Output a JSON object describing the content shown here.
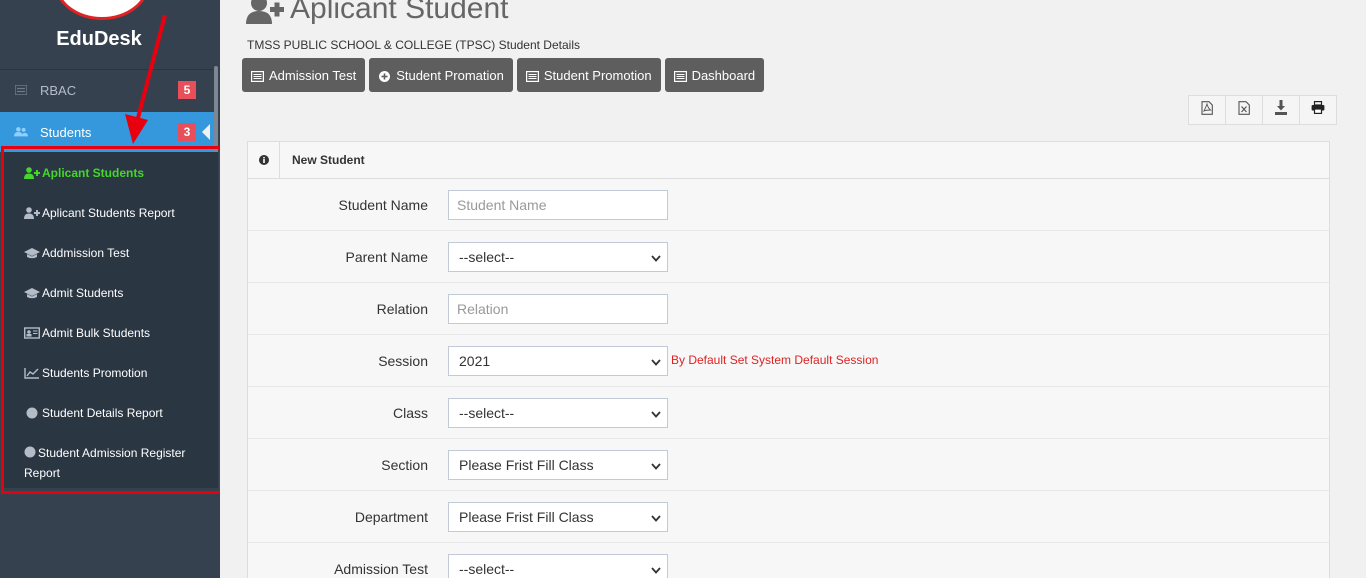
{
  "sidebar": {
    "brand": "EduDesk",
    "menu": [
      {
        "label": "RBAC",
        "badge": "5",
        "icon": "list-icon"
      },
      {
        "label": "Students",
        "badge": "3",
        "icon": "users-icon"
      }
    ],
    "submenu": [
      {
        "label": "Aplicant Students",
        "icon": "user-plus-icon",
        "active": true
      },
      {
        "label": "Aplicant Students Report",
        "icon": "user-plus-icon"
      },
      {
        "label": "Addmission Test",
        "icon": "graduation-cap-icon"
      },
      {
        "label": "Admit Students",
        "icon": "graduation-cap-icon"
      },
      {
        "label": "Admit Bulk Students",
        "icon": "id-card-icon"
      },
      {
        "label": "Students Promotion",
        "icon": "line-chart-icon"
      },
      {
        "label": "Student Details Report",
        "icon": "circle-icon"
      },
      {
        "label": "Student Admission Register Report",
        "icon": "circle-icon"
      }
    ]
  },
  "header": {
    "title": "Aplicant Student",
    "subtitle": "TMSS PUBLIC SCHOOL & COLLEGE (TPSC) Student Details"
  },
  "toolbar": {
    "buttons": [
      {
        "label": "Admission Test",
        "icon": "list-icon"
      },
      {
        "label": "Student Promation",
        "icon": "plus-circle-icon"
      },
      {
        "label": "Student Promotion",
        "icon": "list-icon"
      },
      {
        "label": "Dashboard",
        "icon": "list-icon"
      }
    ],
    "exports": [
      "pdf-icon",
      "excel-icon",
      "download-icon",
      "print-icon"
    ]
  },
  "form": {
    "title": "New Student",
    "fields": [
      {
        "label": "Student Name",
        "type": "input",
        "placeholder": "Student Name",
        "value": ""
      },
      {
        "label": "Parent Name",
        "type": "select",
        "value": "--select--"
      },
      {
        "label": "Relation",
        "type": "input",
        "placeholder": "Relation",
        "value": ""
      },
      {
        "label": "Session",
        "type": "select",
        "value": "2021",
        "hint": "By Default Set System Default Session"
      },
      {
        "label": "Class",
        "type": "select",
        "value": "--select--"
      },
      {
        "label": "Section",
        "type": "select",
        "value": "Please Frist Fill Class"
      },
      {
        "label": "Department",
        "type": "select",
        "value": "Please Frist Fill Class"
      },
      {
        "label": "Admission Test",
        "type": "select",
        "value": "--select--"
      }
    ]
  },
  "colors": {
    "sidebar_bg": "#364150",
    "submenu_bg": "#2b3643",
    "active_menu": "#3598dc",
    "active_sub": "#44d62c",
    "badge": "#e7505a",
    "annotation_red": "#e8000e",
    "button_bg": "#5e5e5e"
  }
}
